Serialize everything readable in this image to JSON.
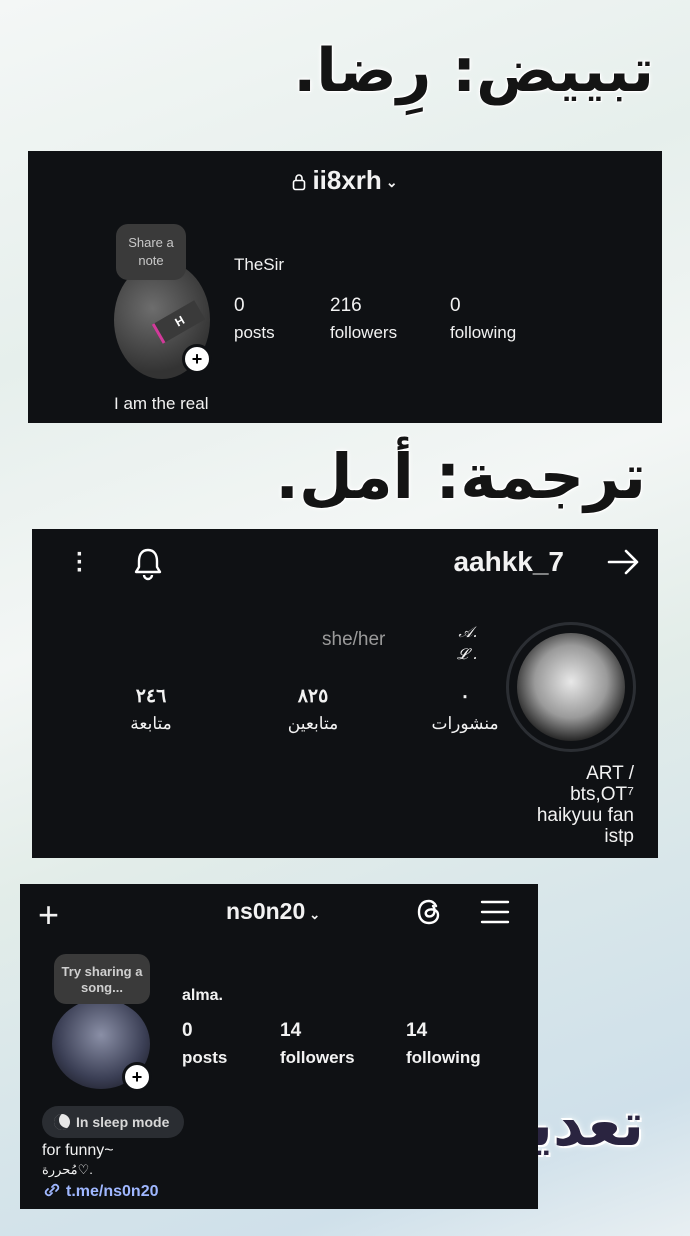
{
  "headings": {
    "first": "تبييض: رِضا.",
    "second": "ترجمة: أمل.",
    "third": "تعديل: ألمى."
  },
  "card1": {
    "username": "ii8xrh",
    "note": "Share a note",
    "display_name": "TheSir",
    "posts_count": "0",
    "posts_label": "posts",
    "followers_count": "216",
    "followers_label": "followers",
    "following_count": "0",
    "following_label": "following",
    "bio": "I am the real",
    "avatar_text": "H"
  },
  "card2": {
    "username": "aahkk_7",
    "pronouns": "she/her",
    "name_line1": "𝒜.",
    "name_line2": "𝓛 .",
    "posts_count": "٠",
    "posts_label": "منشورات",
    "followers_count": "٨٢٥",
    "followers_label": "متابعين",
    "following_count": "٢٤٦",
    "following_label": "متابعة",
    "bio_line1": "ART /",
    "bio_line2": "bts,OT⁷",
    "bio_line3": "haikyuu fan",
    "bio_line4": "istp"
  },
  "card3": {
    "username": "ns0n20",
    "note": "Try sharing a song...",
    "display_name": "alma.",
    "posts_count": "0",
    "posts_label": "posts",
    "followers_count": "14",
    "followers_label": "followers",
    "following_count": "14",
    "following_label": "following",
    "sleep_mode": "In sleep mode",
    "bio_line1": "for funny~",
    "bio_line2": "مُحررة♡.",
    "link": "t.me/ns0n20"
  },
  "icons": [
    "lock-icon",
    "chevron-down-icon",
    "plus-icon",
    "more-vertical-icon",
    "bell-icon",
    "arrow-right-icon",
    "threads-icon",
    "menu-icon",
    "moon-icon",
    "link-icon"
  ]
}
